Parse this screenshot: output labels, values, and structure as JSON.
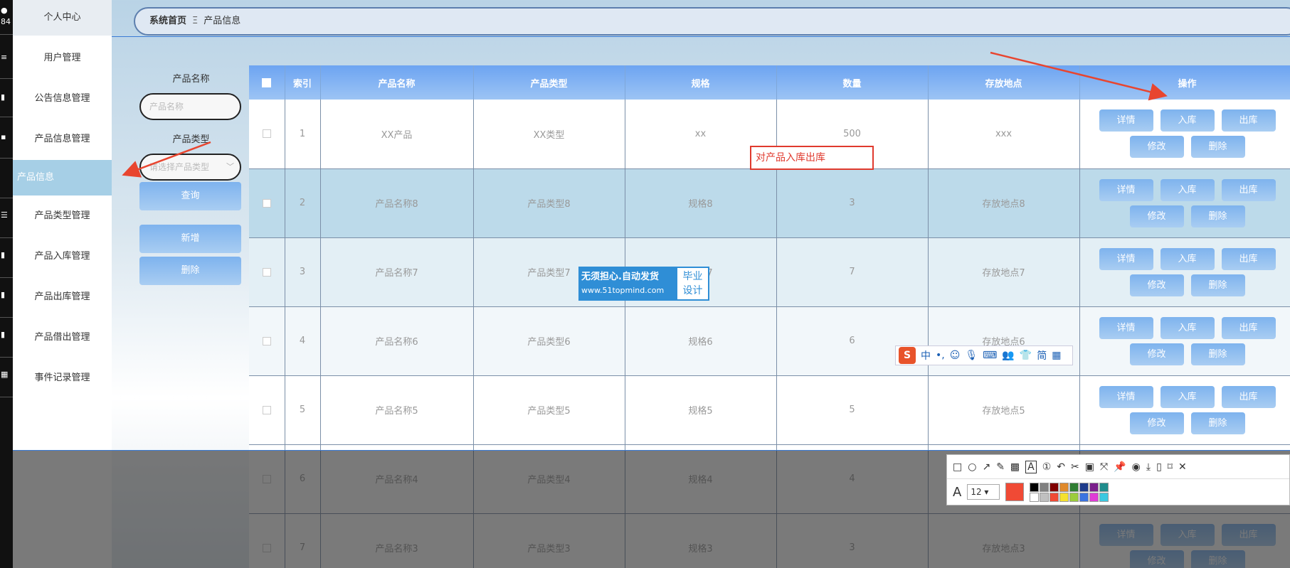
{
  "iconbar": {
    "top_label": "84"
  },
  "sidebar": {
    "top": "个人中心",
    "items": [
      {
        "label": "用户管理"
      },
      {
        "label": "公告信息管理"
      },
      {
        "label": "产品信息管理"
      },
      {
        "label": "产品信息",
        "active": true
      },
      {
        "label": "产品类型管理"
      },
      {
        "label": "产品入库管理"
      },
      {
        "label": "产品出库管理"
      },
      {
        "label": "产品借出管理"
      },
      {
        "label": "事件记录管理"
      }
    ]
  },
  "breadcrumb": {
    "home": "系统首页",
    "separator": "Ξ",
    "current": "产品信息"
  },
  "search": {
    "name_label": "产品名称",
    "name_placeholder": "产品名称",
    "type_label": "产品类型",
    "type_placeholder": "请选择产品类型",
    "query_button": "查询",
    "add_button": "新增",
    "delete_button": "删除"
  },
  "table": {
    "headers": [
      "索引",
      "产品名称",
      "产品类型",
      "规格",
      "数量",
      "存放地点",
      "操作"
    ],
    "rows": [
      {
        "index": "1",
        "name": "XX产品",
        "type": "XX类型",
        "spec": "xx",
        "qty": "500",
        "location": "xxx"
      },
      {
        "index": "2",
        "name": "产品名称8",
        "type": "产品类型8",
        "spec": "规格8",
        "qty": "3",
        "location": "存放地点8"
      },
      {
        "index": "3",
        "name": "产品名称7",
        "type": "产品类型7",
        "spec": "规格7",
        "qty": "7",
        "location": "存放地点7"
      },
      {
        "index": "4",
        "name": "产品名称6",
        "type": "产品类型6",
        "spec": "规格6",
        "qty": "6",
        "location": "存放地点6"
      },
      {
        "index": "5",
        "name": "产品名称5",
        "type": "产品类型5",
        "spec": "规格5",
        "qty": "5",
        "location": "存放地点5"
      },
      {
        "index": "6",
        "name": "产品名称4",
        "type": "产品类型4",
        "spec": "规格4",
        "qty": "4",
        "location": ""
      },
      {
        "index": "7",
        "name": "产品名称3",
        "type": "产品类型3",
        "spec": "规格3",
        "qty": "3",
        "location": "存放地点3"
      }
    ],
    "actions": {
      "detail": "详情",
      "in": "入库",
      "out": "出库",
      "edit": "修改",
      "delete": "删除"
    }
  },
  "annotation": {
    "text": "对产品入库出库"
  },
  "watermark": {
    "line1": "无须担心.自动发货",
    "line2": "www.51topmind.com",
    "badge1": "毕业",
    "badge2": "设计"
  },
  "ime": {
    "logo": "S",
    "lang": "中",
    "punct": "•,",
    "simp": "简"
  },
  "snip_tool": {
    "font_size": "12",
    "font_icon": "A",
    "current_color": "#f04a35"
  },
  "colors": {
    "accent": "#7eb3ee",
    "header": "#6da4f2",
    "annotation": "#e03a2e"
  }
}
